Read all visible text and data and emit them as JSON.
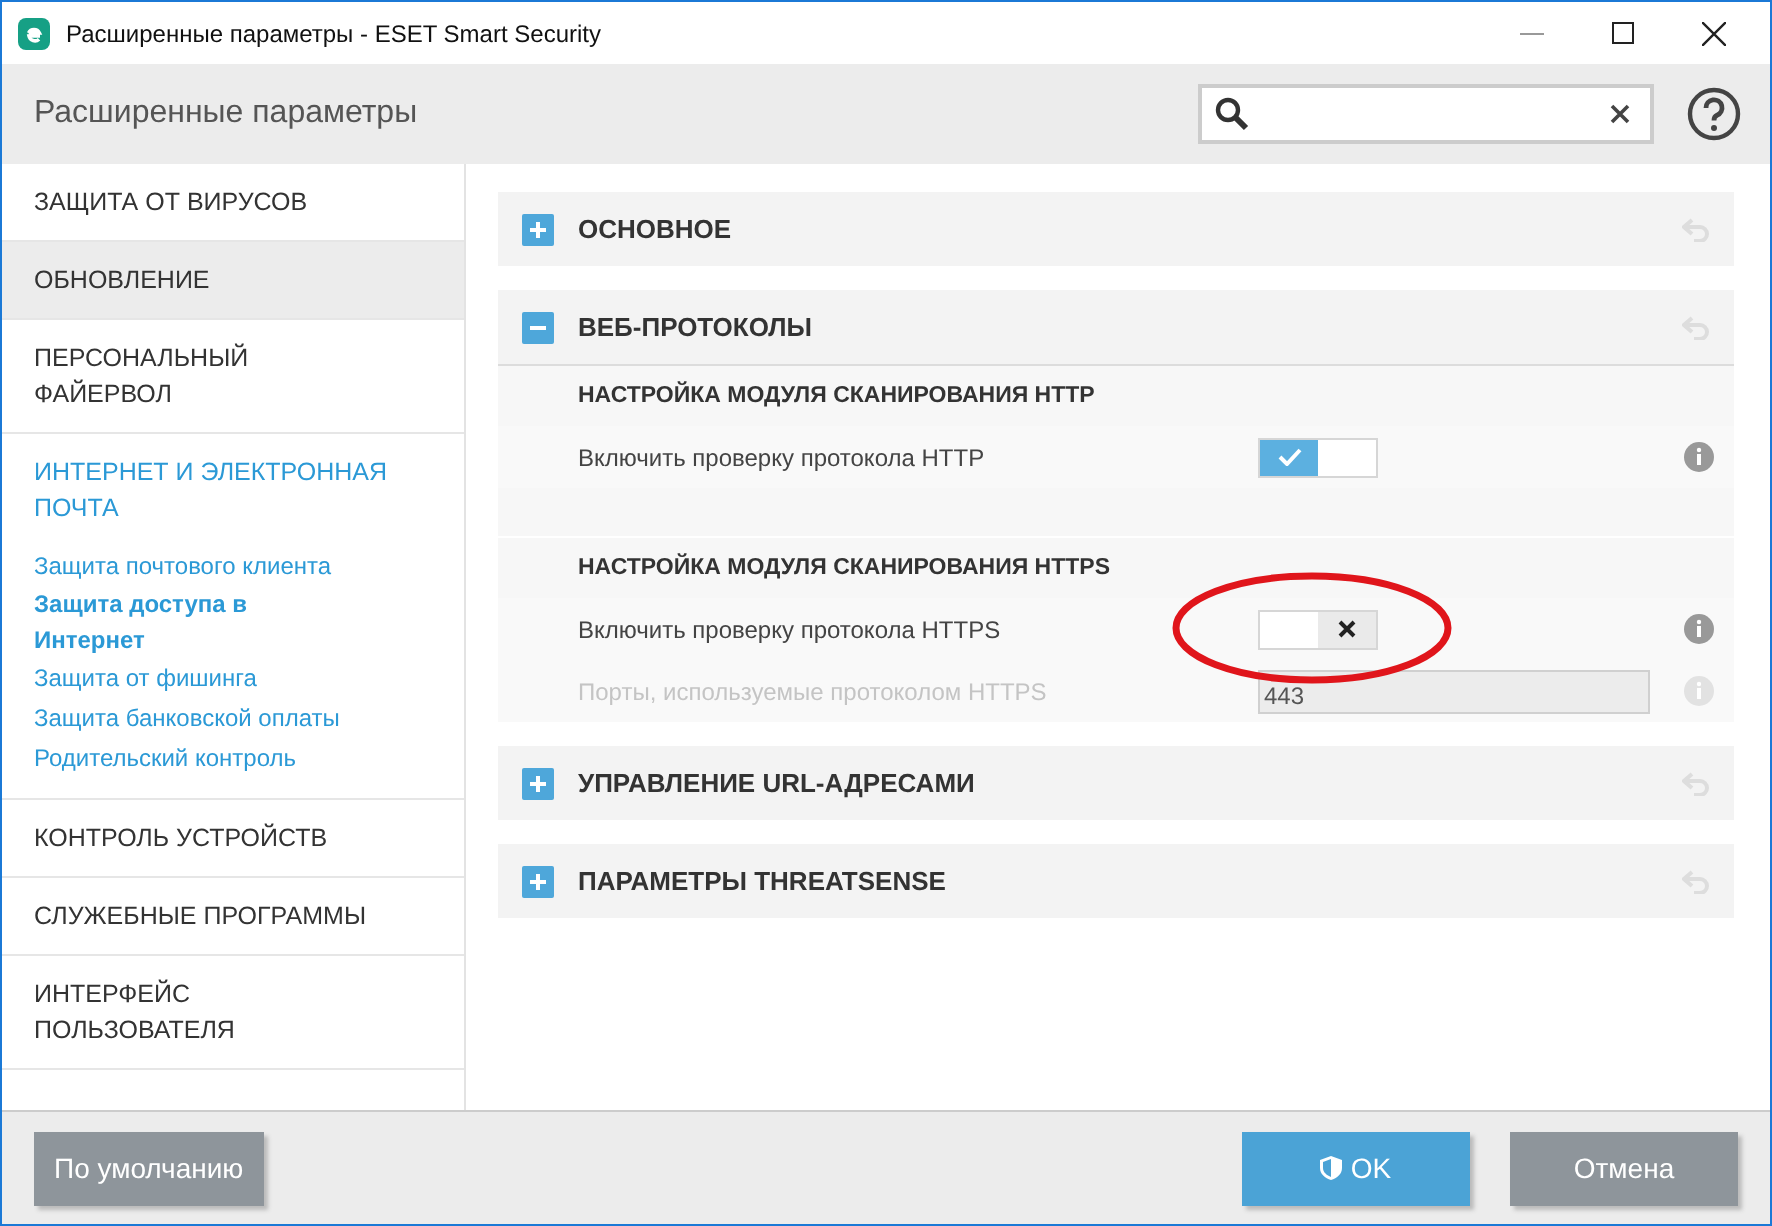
{
  "window": {
    "title": "Расширенные параметры - ESET Smart Security"
  },
  "header": {
    "title": "Расширенные параметры"
  },
  "sidebar": {
    "items": [
      {
        "label": "ЗАЩИТА ОТ ВИРУСОВ",
        "selected": false,
        "hovered": false
      },
      {
        "label": "ОБНОВЛЕНИЕ",
        "selected": false,
        "hovered": true
      },
      {
        "label": "ПЕРСОНАЛЬНЫЙ ФАЙЕРВОЛ",
        "selected": false,
        "hovered": false
      },
      {
        "label": "ИНТЕРНЕТ И ЭЛЕКТРОННАЯ ПОЧТА",
        "selected": true,
        "hovered": false,
        "children": [
          {
            "label": "Защита почтового клиента",
            "selected": false
          },
          {
            "label": "Защита доступа в Интернет",
            "selected": true
          },
          {
            "label": "Защита от фишинга",
            "selected": false
          },
          {
            "label": "Защита банковской оплаты",
            "selected": false
          },
          {
            "label": "Родительский контроль",
            "selected": false
          }
        ]
      },
      {
        "label": "КОНТРОЛЬ УСТРОЙСТВ",
        "selected": false,
        "hovered": false
      },
      {
        "label": "СЛУЖЕБНЫЕ ПРОГРАММЫ",
        "selected": false,
        "hovered": false
      },
      {
        "label": "ИНТЕРФЕЙС ПОЛЬЗОВАТЕЛЯ",
        "selected": false,
        "hovered": false
      }
    ]
  },
  "sections": [
    {
      "title": "ОСНОВНОЕ",
      "expanded": false
    },
    {
      "title": "ВЕБ-ПРОТОКОЛЫ",
      "expanded": true,
      "groups": [
        {
          "heading": "НАСТРОЙКА МОДУЛЯ СКАНИРОВАНИЯ HTTP",
          "rows": [
            {
              "kind": "toggle",
              "label": "Включить проверку протокола HTTP",
              "on": true,
              "disabled": false
            }
          ]
        },
        {
          "heading": "НАСТРОЙКА МОДУЛЯ СКАНИРОВАНИЯ HTTPS",
          "rows": [
            {
              "kind": "toggle",
              "label": "Включить проверку протокола HTTPS",
              "on": false,
              "disabled": false
            },
            {
              "kind": "field",
              "label": "Порты, используемые протоколом HTTPS",
              "value": "443",
              "disabled": true
            }
          ]
        }
      ]
    },
    {
      "title": "УПРАВЛЕНИЕ URL-АДРЕСАМИ",
      "expanded": false
    },
    {
      "title": "ПАРАМЕТРЫ THREATSENSE",
      "expanded": false
    }
  ],
  "footer": {
    "buttons": [
      {
        "label": "По умолчанию",
        "kind": "secondary"
      },
      {
        "label": "OK",
        "kind": "primary"
      },
      {
        "label": "Отмена",
        "kind": "secondary"
      }
    ]
  }
}
